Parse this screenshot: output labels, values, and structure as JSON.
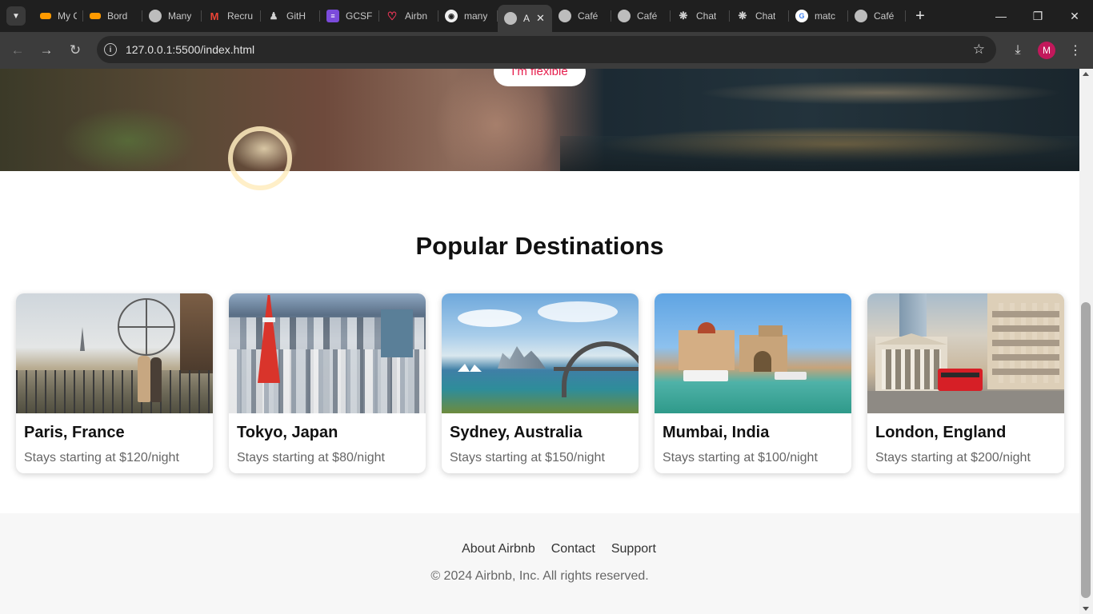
{
  "browser": {
    "tabs": [
      {
        "title": "My C",
        "favicon": "orange-logo"
      },
      {
        "title": "Bord",
        "favicon": "orange-logo"
      },
      {
        "title": "Many",
        "favicon": "globe"
      },
      {
        "title": "Recru",
        "favicon": "gmail"
      },
      {
        "title": "GitH",
        "favicon": "github"
      },
      {
        "title": "GCSF",
        "favicon": "purple-list"
      },
      {
        "title": "Airbn",
        "favicon": "airbnb"
      },
      {
        "title": "many",
        "favicon": "github"
      },
      {
        "title": "A",
        "favicon": "globe",
        "active": true
      },
      {
        "title": "Café",
        "favicon": "globe"
      },
      {
        "title": "Café",
        "favicon": "globe"
      },
      {
        "title": "Chat",
        "favicon": "openai"
      },
      {
        "title": "Chat",
        "favicon": "openai"
      },
      {
        "title": "matc",
        "favicon": "google"
      },
      {
        "title": "Café",
        "favicon": "globe"
      }
    ],
    "url": "127.0.0.1:5500/index.html",
    "profile_initial": "M"
  },
  "hero": {
    "flexible_button": "I'm flexible"
  },
  "section": {
    "title": "Popular Destinations"
  },
  "destinations": [
    {
      "name": "Paris, France",
      "price": "Stays starting at $120/night"
    },
    {
      "name": "Tokyo, Japan",
      "price": "Stays starting at $80/night"
    },
    {
      "name": "Sydney, Australia",
      "price": "Stays starting at $150/night"
    },
    {
      "name": "Mumbai, India",
      "price": "Stays starting at $100/night"
    },
    {
      "name": "London, England",
      "price": "Stays starting at $200/night"
    }
  ],
  "footer": {
    "links": [
      "About Airbnb",
      "Contact",
      "Support"
    ],
    "copyright": "© 2024 Airbnb, Inc. All rights reserved."
  },
  "colors": {
    "brand": "#e61e4d",
    "chrome_dark": "#1f1f1f",
    "toolbar": "#3c3c3c"
  }
}
